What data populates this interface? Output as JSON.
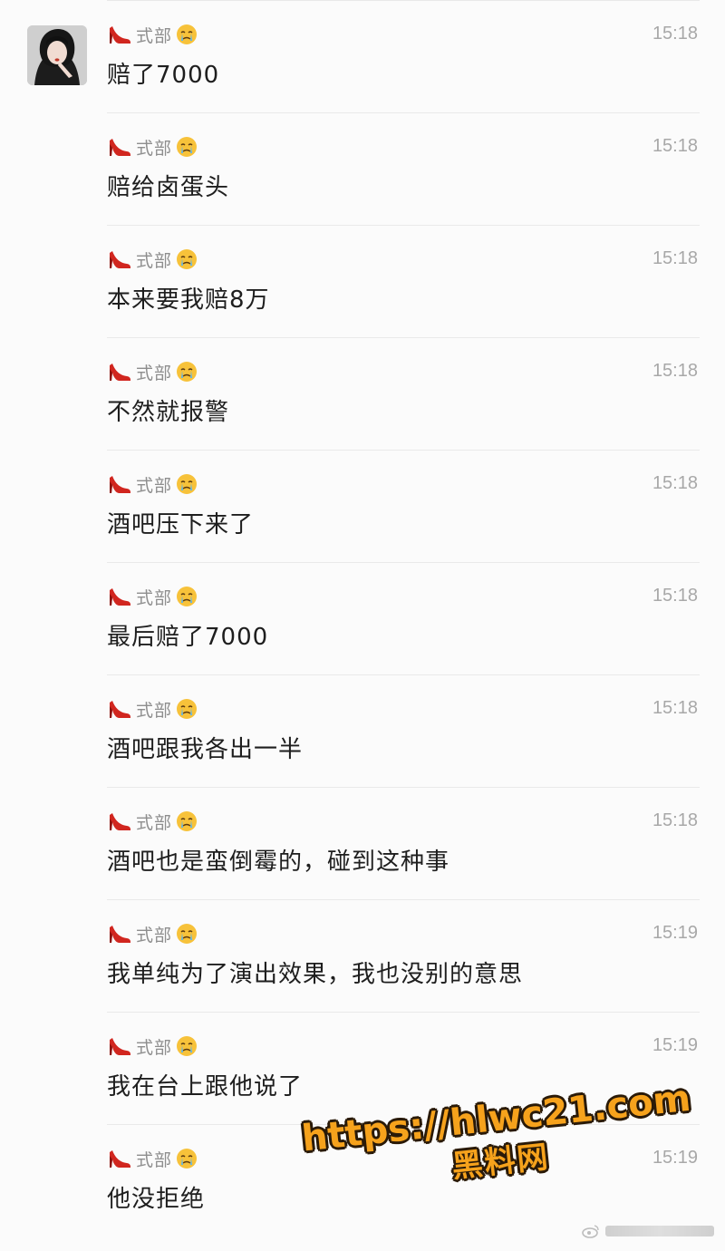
{
  "sender_name": "式部",
  "messages": [
    {
      "time": "15:18",
      "text": "赔了7000"
    },
    {
      "time": "15:18",
      "text": "赔给卤蛋头"
    },
    {
      "time": "15:18",
      "text": "本来要我赔8万"
    },
    {
      "time": "15:18",
      "text": "不然就报警"
    },
    {
      "time": "15:18",
      "text": "酒吧压下来了"
    },
    {
      "time": "15:18",
      "text": "最后赔了7000"
    },
    {
      "time": "15:18",
      "text": "酒吧跟我各出一半"
    },
    {
      "time": "15:18",
      "text": "酒吧也是蛮倒霉的，碰到这种事"
    },
    {
      "time": "15:19",
      "text": "我单纯为了演出效果，我也没别的意思"
    },
    {
      "time": "15:19",
      "text": "我在台上跟他说了"
    },
    {
      "time": "15:19",
      "text": "他没拒绝"
    }
  ],
  "watermark": {
    "url": "https://hlwc21.com",
    "name": "黑料网"
  },
  "icons": {
    "sender_prefix": "high-heel-icon",
    "sender_suffix": "crying-face-icon",
    "corner": "weibo-logo-icon"
  },
  "colors": {
    "background": "#fbfbfb",
    "message_text": "#1e1e1e",
    "sender_text": "#8e8e8e",
    "time_text": "#a8a8a8",
    "watermark_fill": "#f6a21c"
  }
}
